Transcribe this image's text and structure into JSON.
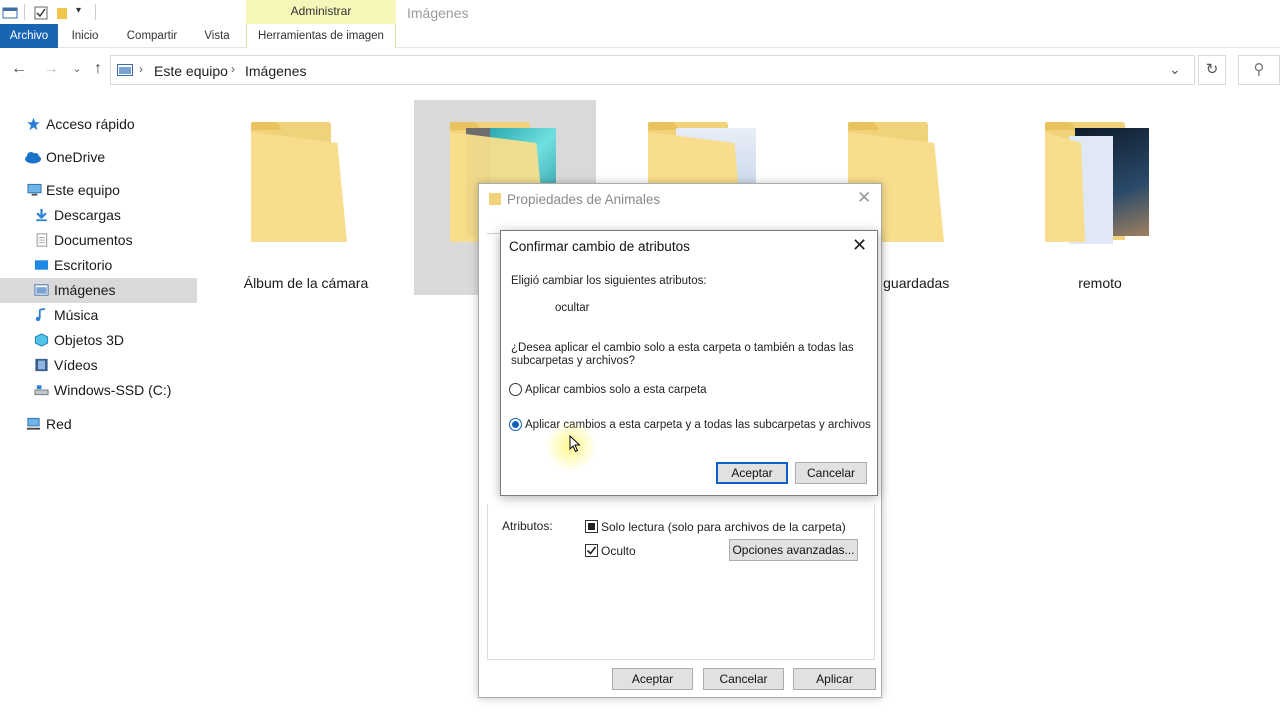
{
  "ribbon": {
    "context_group": "Administrar",
    "window_title": "Imágenes",
    "tabs": [
      "Archivo",
      "Inicio",
      "Compartir",
      "Vista",
      "Herramientas de imagen"
    ]
  },
  "address": {
    "crumbs": [
      "Este equipo",
      "Imágenes"
    ]
  },
  "sidebar": {
    "items": [
      {
        "label": "Acceso rápido",
        "icon": "star-icon"
      },
      {
        "label": "OneDrive",
        "icon": "cloud-icon"
      },
      {
        "label": "Este equipo",
        "icon": "computer-icon"
      },
      {
        "label": "Descargas",
        "icon": "download-icon"
      },
      {
        "label": "Documentos",
        "icon": "document-icon"
      },
      {
        "label": "Escritorio",
        "icon": "desktop-icon"
      },
      {
        "label": "Imágenes",
        "icon": "pictures-icon",
        "selected": true
      },
      {
        "label": "Música",
        "icon": "music-icon"
      },
      {
        "label": "Objetos 3D",
        "icon": "cube-icon"
      },
      {
        "label": "Vídeos",
        "icon": "video-icon"
      },
      {
        "label": "Windows-SSD (C:)",
        "icon": "drive-icon"
      },
      {
        "label": "Red",
        "icon": "network-icon"
      }
    ]
  },
  "folders": [
    {
      "label": "Álbum de la cámara"
    },
    {
      "label": ""
    },
    {
      "label": ""
    },
    {
      "label": "nes guardadas"
    },
    {
      "label": "remoto"
    }
  ],
  "properties_dialog": {
    "title": "Propiedades de Animales",
    "attributes_label": "Atributos:",
    "readonly_label": "Solo lectura (solo para archivos de la carpeta)",
    "hidden_label": "Oculto",
    "hidden_checked": true,
    "advanced_button": "Opciones avanzadas...",
    "ok_button": "Aceptar",
    "cancel_button": "Cancelar",
    "apply_button": "Aplicar"
  },
  "confirm_dialog": {
    "title": "Confirmar cambio de atributos",
    "intro": "Eligió cambiar los siguientes atributos:",
    "attribute": "ocultar",
    "question_line1": "¿Desea aplicar el cambio solo a esta carpeta o también a todas las",
    "question_line2": "subcarpetas y archivos?",
    "option1": "Aplicar cambios solo a esta carpeta",
    "option2": "Aplicar cambios a esta carpeta y a todas las subcarpetas y archivos",
    "selected_option": 2,
    "ok_button": "Aceptar",
    "cancel_button": "Cancelar"
  },
  "colors": {
    "accent": "#1a64b4",
    "context_tab": "#f5f6b8",
    "selection": "#d9d9d9",
    "folder": "#f8de8c"
  }
}
